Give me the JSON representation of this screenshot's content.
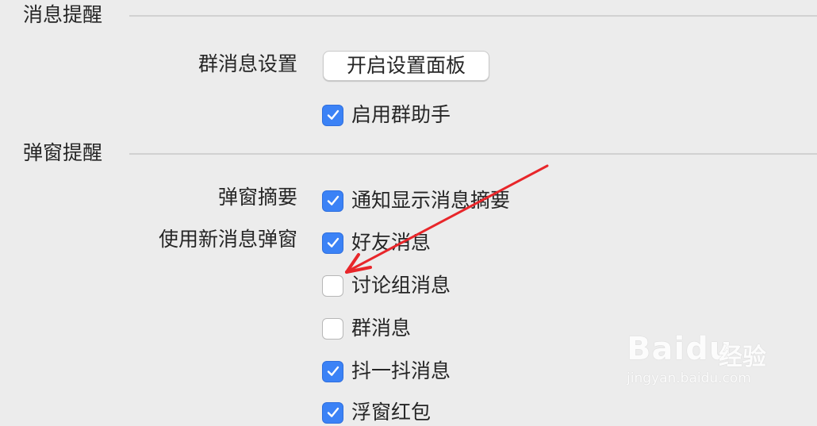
{
  "sections": {
    "message_reminder": {
      "title": "消息提醒"
    },
    "popup_reminder": {
      "title": "弹窗提醒"
    }
  },
  "group_settings": {
    "label": "群消息设置",
    "button_label": "开启设置面板"
  },
  "enable_group_helper": {
    "label": "启用群助手",
    "checked": true
  },
  "popup_summary": {
    "label": "弹窗摘要",
    "option": {
      "label": "通知显示消息摘要",
      "checked": true
    }
  },
  "new_message_popup": {
    "label": "使用新消息弹窗",
    "options": [
      {
        "label": "好友消息",
        "checked": true
      },
      {
        "label": "讨论组消息",
        "checked": false
      },
      {
        "label": "群消息",
        "checked": false
      },
      {
        "label": "抖一抖消息",
        "checked": true
      },
      {
        "label": "浮窗红包",
        "checked": true
      }
    ]
  },
  "annotation": {
    "arrow_color": "#e8262a"
  },
  "colors": {
    "checkbox_on": "#3b82f6",
    "background": "#ececec"
  },
  "watermark": {
    "brand": "Baidu",
    "cn": "经验",
    "url": "jingyan.baidu.com"
  }
}
